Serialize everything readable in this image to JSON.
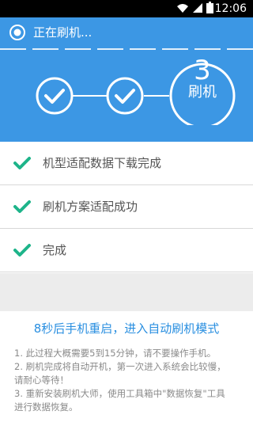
{
  "status_bar": {
    "time": "12:06",
    "icons": [
      "wifi-icon",
      "signal-icon",
      "battery-icon"
    ]
  },
  "header": {
    "title": "正在刷机..."
  },
  "steps": {
    "step1": {
      "state": "done",
      "icon": "check-icon"
    },
    "step2": {
      "state": "done",
      "icon": "check-icon"
    },
    "step3": {
      "number": "3",
      "label": "刷机"
    }
  },
  "tasks": [
    {
      "label": "机型适配数据下载完成",
      "status": "done"
    },
    {
      "label": "刷机方案适配成功",
      "status": "done"
    },
    {
      "label": "完成",
      "status": "done"
    }
  ],
  "restart_message": "8秒后手机重启，进入自动刷机模式",
  "notes": [
    "1. 此过程大概需要5到15分钟，请不要操作手机。",
    "2. 刷机完成将自动开机，第一次进入系统会比较慢，",
    "请耐心等待！",
    "3. 重新安装刷机大师，使用工具箱中\"数据恢复\"工具",
    "进行数据恢复。"
  ],
  "colors": {
    "primary_blue": "#3c97e4",
    "check_green": "#1eb48a",
    "link_blue": "#2a8fe0"
  }
}
